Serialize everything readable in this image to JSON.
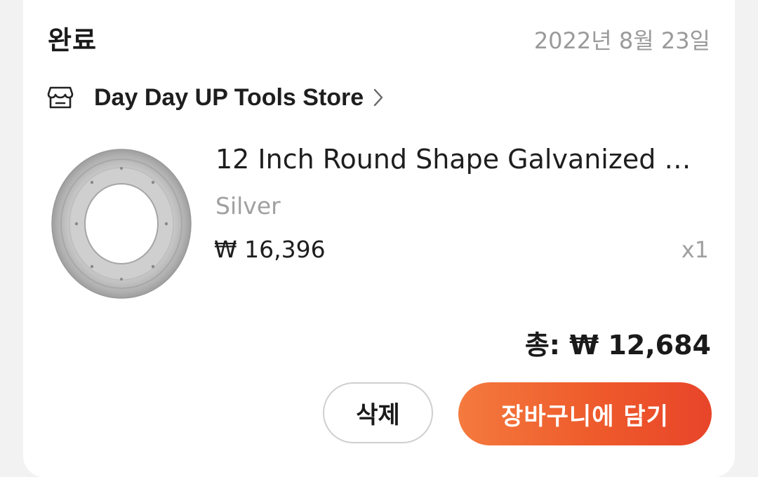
{
  "order": {
    "status": "완료",
    "date": "2022년 8월 23일"
  },
  "store": {
    "icon": "store-icon",
    "name": "Day Day UP Tools Store",
    "chevron_icon": "chevron-right-icon"
  },
  "item": {
    "title": "12 Inch Round Shape Galvanized T…",
    "variant": "Silver",
    "price": "₩ 16,396",
    "quantity": "x1"
  },
  "summary": {
    "total": "총: ₩ 12,684"
  },
  "actions": {
    "delete_label": "삭제",
    "add_to_cart_label": "장바구니에 담기"
  },
  "colors": {
    "accent": "#ee5a2b",
    "muted_text": "#9a9a9a"
  }
}
